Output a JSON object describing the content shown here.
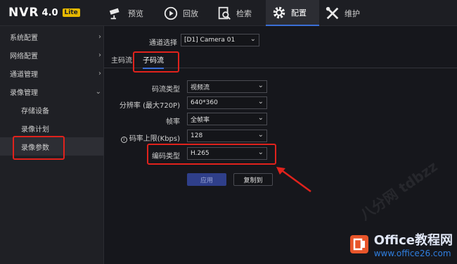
{
  "brand": {
    "name": "NVR",
    "version": "4.0",
    "edition": "Lite"
  },
  "nav": [
    {
      "label": "预览",
      "icon": "camera-icon"
    },
    {
      "label": "回放",
      "icon": "playback-icon"
    },
    {
      "label": "检索",
      "icon": "search-doc-icon"
    },
    {
      "label": "配置",
      "icon": "gear-icon",
      "active": true
    },
    {
      "label": "维护",
      "icon": "tools-icon"
    }
  ],
  "sidebar": {
    "items": [
      {
        "label": "系统配置",
        "chevron": "›"
      },
      {
        "label": "网络配置",
        "chevron": "›"
      },
      {
        "label": "通道管理",
        "chevron": "›"
      },
      {
        "label": "录像管理",
        "chevron": "⌄"
      },
      {
        "label": "存储设备"
      },
      {
        "label": "录像计划"
      },
      {
        "label": "录像参数",
        "selected": true
      }
    ]
  },
  "channel": {
    "label": "通道选择",
    "value": "[D1] Camera 01"
  },
  "tabs": [
    {
      "label": "主码流"
    },
    {
      "label": "子码流",
      "active": true
    }
  ],
  "form": [
    {
      "label": "码流类型",
      "value": "视频流"
    },
    {
      "label": "分辨率 (最大720P)",
      "value": "640*360"
    },
    {
      "label": "帧率",
      "value": "全帧率"
    },
    {
      "label": "码率上限(Kbps)",
      "value": "128",
      "info": true
    },
    {
      "label": "编码类型",
      "value": "H.265"
    }
  ],
  "buttons": {
    "apply": "应用",
    "copy": "复制到"
  },
  "watermark": {
    "title": "Office教程网",
    "url": "www.office26.com",
    "diag": "八分网 tdbzz"
  },
  "colors": {
    "accent": "#3b6fd6",
    "highlight": "#e0221c",
    "background": "#16171c"
  }
}
